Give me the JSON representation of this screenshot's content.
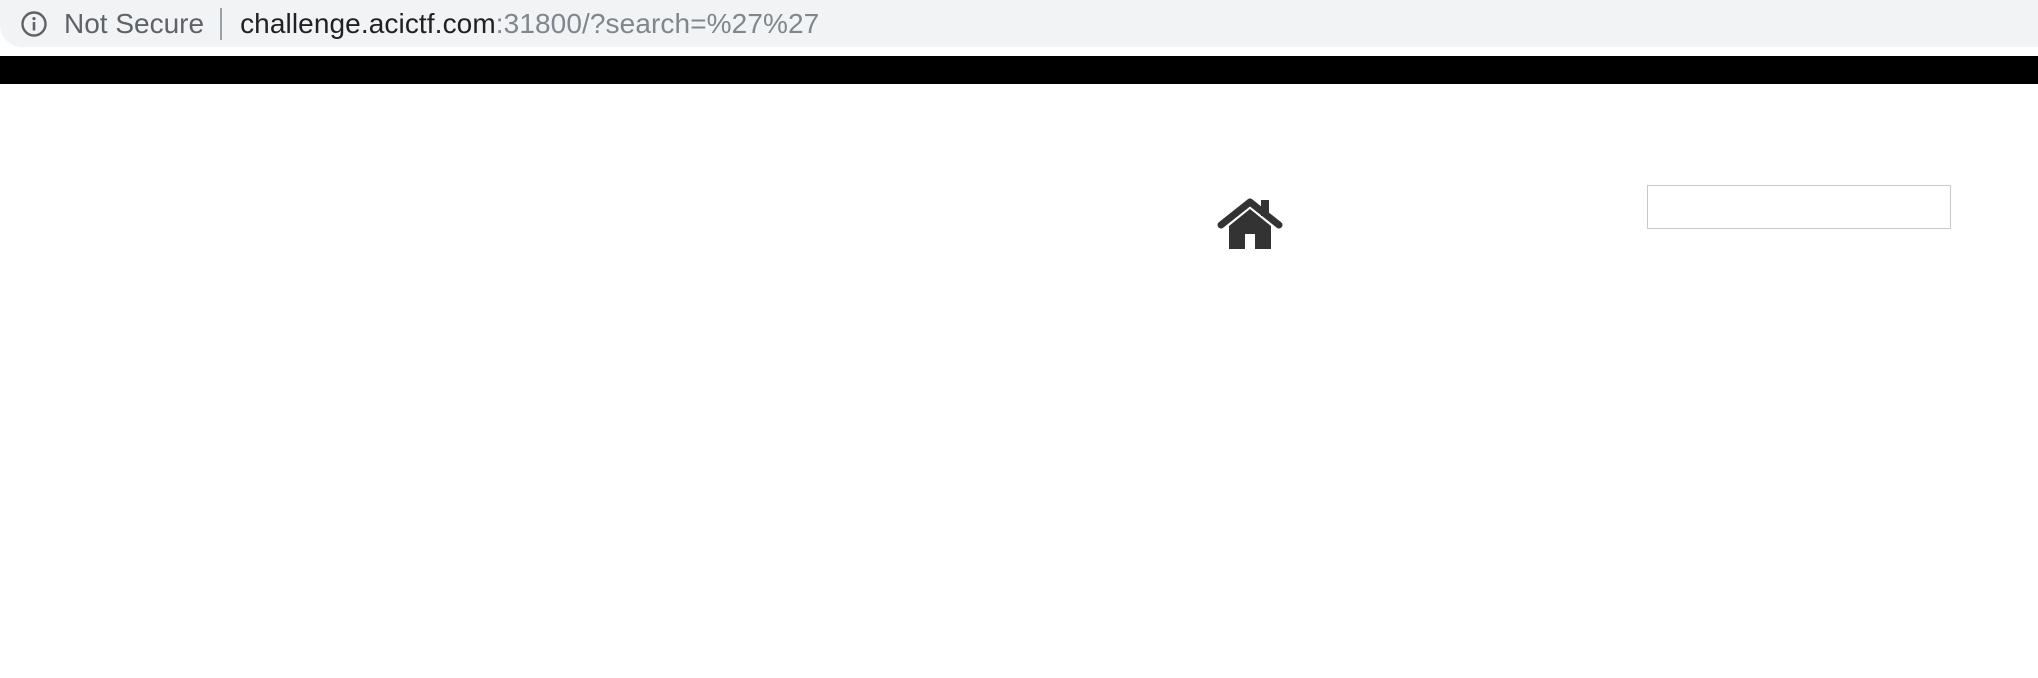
{
  "browser": {
    "security_label": "Not Secure",
    "url_host": "challenge.acictf.com",
    "url_rest": ":31800/?search=%27%27",
    "security_icon": "info-icon"
  },
  "page": {
    "topbar_color": "#000000",
    "home_icon": "home-icon",
    "search": {
      "value": "",
      "placeholder": ""
    }
  }
}
